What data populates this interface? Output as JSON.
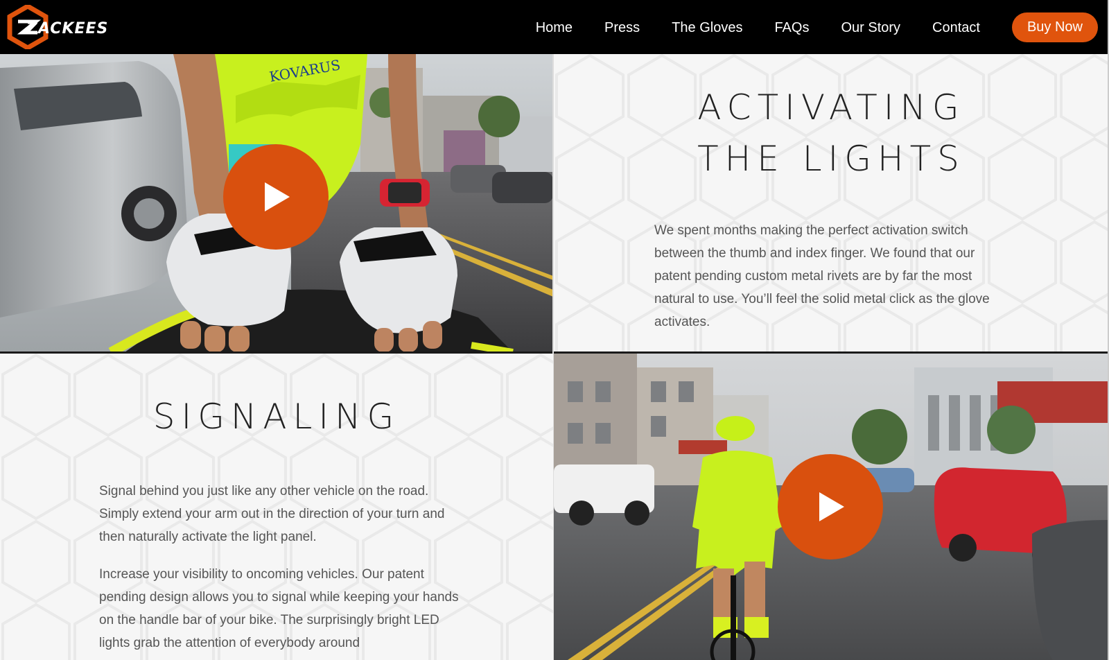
{
  "brand": {
    "name": "ZACKEES",
    "accent": "#e0540d"
  },
  "nav": {
    "items": [
      "Home",
      "Press",
      "The Gloves",
      "FAQs",
      "Our Story",
      "Contact"
    ],
    "cta": "Buy Now"
  },
  "activating": {
    "title_line1": "ACTIVATING",
    "title_line2": "THE LIGHTS",
    "body": "We spent months making the perfect activation switch between the thumb and index finger. We found that our patent pending custom metal rivets are by far the most natural to use. You’ll feel the solid metal click as the glove activates."
  },
  "signaling": {
    "title": "SIGNALING",
    "body1": "Signal behind you just like any other vehicle on the road. Simply extend your arm out in the direction of your turn and then naturally activate the light panel.",
    "body2": "Increase your visibility to oncoming vehicles. Our patent pending design allows you to signal while keeping your hands on the handle bar of your bike. The surprisingly bright LED lights grab the attention of everybody around"
  },
  "videos": [
    {
      "icon": "play-icon",
      "subject": "cyclist hands on handlebar wearing gloves"
    },
    {
      "icon": "play-icon",
      "subject": "cyclist riding on city street"
    }
  ]
}
